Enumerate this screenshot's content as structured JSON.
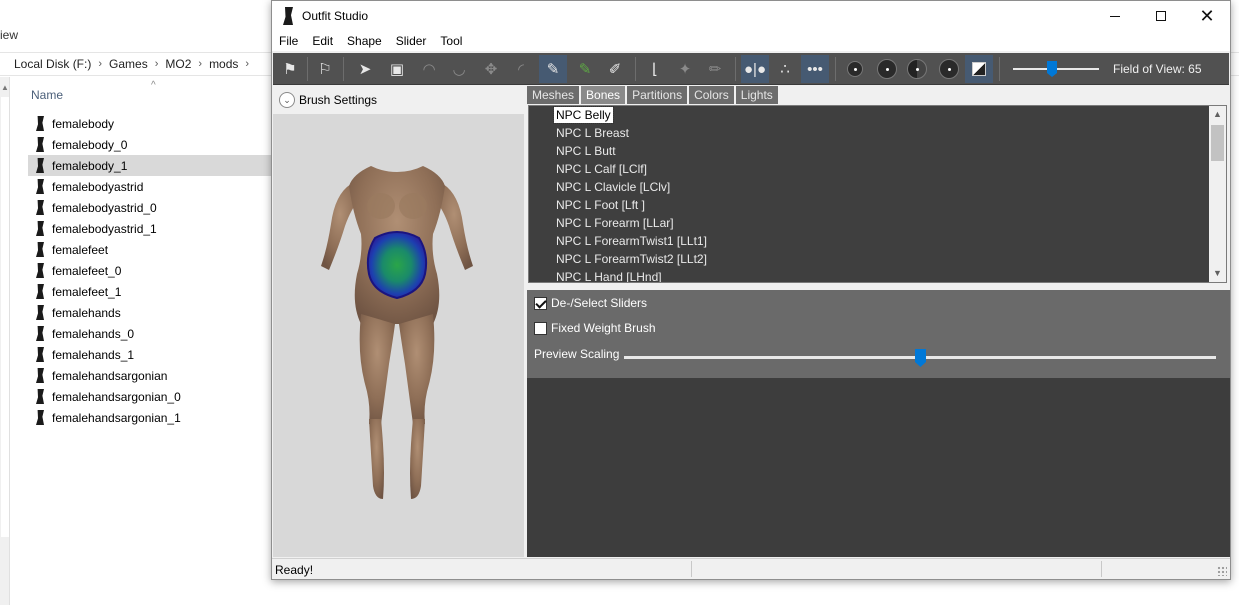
{
  "explorer": {
    "view_menu": "iew",
    "breadcrumb": [
      "Local Disk (F:)",
      "Games",
      "MO2",
      "mods"
    ],
    "column_name": "Name",
    "files": [
      {
        "name": "femalebody"
      },
      {
        "name": "femalebody_0"
      },
      {
        "name": "femalebody_1"
      },
      {
        "name": "femalebodyastrid"
      },
      {
        "name": "femalebodyastrid_0"
      },
      {
        "name": "femalebodyastrid_1"
      },
      {
        "name": "femalefeet"
      },
      {
        "name": "femalefeet_0"
      },
      {
        "name": "femalefeet_1"
      },
      {
        "name": "femalehands"
      },
      {
        "name": "femalehands_0"
      },
      {
        "name": "femalehands_1"
      },
      {
        "name": "femalehandsargonian"
      },
      {
        "name": "femalehandsargonian_0"
      },
      {
        "name": "femalehandsargonian_1"
      }
    ],
    "selected_file": "femalebody_1"
  },
  "window": {
    "title": "Outfit Studio",
    "menus": [
      "File",
      "Edit",
      "Shape",
      "Slider",
      "Tool"
    ],
    "fov_label": "Field of View: 65",
    "fov_value": 65,
    "fov_slider_fraction": 0.45
  },
  "left_panel": {
    "brush_settings_label": "Brush Settings"
  },
  "tabs": [
    {
      "label": "Meshes",
      "active": false
    },
    {
      "label": "Bones",
      "active": true
    },
    {
      "label": "Partitions",
      "active": false
    },
    {
      "label": "Colors",
      "active": false
    },
    {
      "label": "Lights",
      "active": false
    }
  ],
  "bones": [
    "NPC Belly",
    "NPC L Breast",
    "NPC L Butt",
    "NPC L Calf [LClf]",
    "NPC L Clavicle [LClv]",
    "NPC L Foot [Lft ]",
    "NPC L Forearm [LLar]",
    "NPC L ForearmTwist1 [LLt1]",
    "NPC L ForearmTwist2 [LLt2]",
    "NPC L Hand [LHnd]"
  ],
  "selected_bone": "NPC Belly",
  "options": {
    "deselect_sliders_label": "De-/Select Sliders",
    "deselect_sliders_checked": true,
    "fixed_weight_label": "Fixed Weight Brush",
    "fixed_weight_checked": false,
    "preview_scaling_label": "Preview Scaling",
    "preview_scaling_fraction": 0.5
  },
  "status": {
    "text": "Ready!"
  },
  "colors": {
    "toolbar_bg": "#515151",
    "accent_blue": "#0078d7",
    "active_tool": "#465a72"
  }
}
